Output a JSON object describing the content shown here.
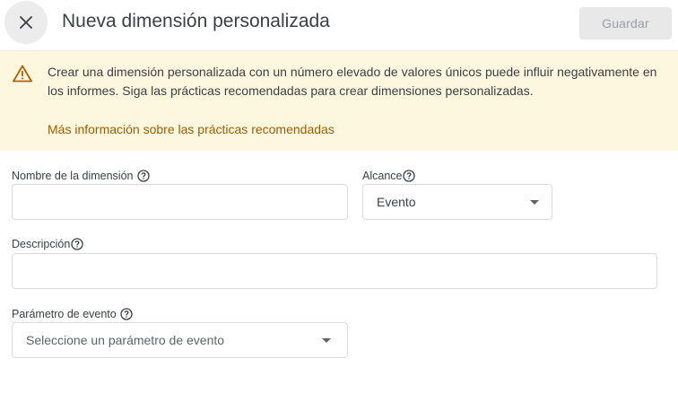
{
  "header": {
    "title": "Nueva dimensión personalizada",
    "save_label": "Guardar",
    "close_icon": "close-icon"
  },
  "alert": {
    "icon": "warning-icon",
    "text": "Crear una dimensión personalizada con un número elevado de valores únicos puede influir negativamente en los informes. Siga las prácticas recomendadas para crear dimensiones personalizadas.",
    "link": "Más información sobre las prácticas recomendadas",
    "background": "#fef7e0",
    "link_color": "#a15c00",
    "icon_color": "#b06000"
  },
  "form": {
    "dimension_name": {
      "label": "Nombre de la dimensión",
      "value": ""
    },
    "scope": {
      "label": "Alcance",
      "selected": "Evento"
    },
    "description": {
      "label": "Descripción",
      "value": ""
    },
    "event_parameter": {
      "label": "Parámetro de evento",
      "placeholder": "Seleccione un parámetro de evento"
    }
  }
}
